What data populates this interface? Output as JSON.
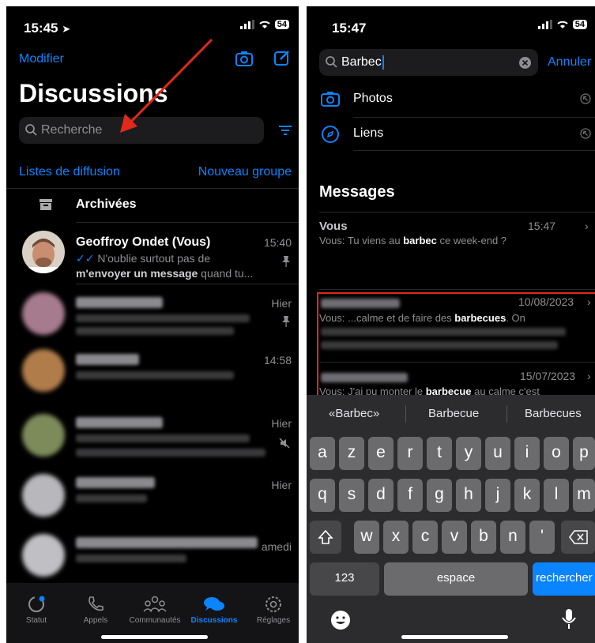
{
  "left": {
    "status": {
      "time": "15:45",
      "battery": "54"
    },
    "nav": {
      "edit": "Modifier",
      "title": "Discussions"
    },
    "search": {
      "placeholder": "Recherche"
    },
    "links": {
      "broadcast": "Listes de diffusion",
      "new_group": "Nouveau groupe"
    },
    "archived": "Archivées",
    "chats": [
      {
        "name": "Geoffroy Ondet (Vous)",
        "time": "15:40",
        "line1": "N'oublie surtout pas de",
        "line2_bold": "m'envoyer un message",
        "line2_rest": " quand tu..."
      },
      {
        "time": "Hier"
      },
      {
        "time": "14:58"
      },
      {
        "time": "Hier"
      },
      {
        "time": "Hier"
      },
      {
        "time": "amedi"
      }
    ],
    "tabs": [
      "Statut",
      "Appels",
      "Communautés",
      "Discussions",
      "Réglages"
    ]
  },
  "right": {
    "status": {
      "time": "15:47",
      "battery": "54"
    },
    "search": {
      "value": "Barbec",
      "cancel": "Annuler"
    },
    "filters": [
      "Photos",
      "Liens"
    ],
    "section": "Messages",
    "results": [
      {
        "from": "Vous",
        "time": "15:47",
        "prefix": "Vous: Tu viens au ",
        "bold": "barbec",
        "suffix": " ce week-end ?"
      },
      {
        "time": "10/08/2023",
        "prefix": "Vous: ...calme et de faire des ",
        "bold": "barbecues",
        "suffix": ". On"
      },
      {
        "time": "15/07/2023",
        "prefix": "Vous: J'ai pu monter le ",
        "bold": "barbecue",
        "suffix": " au calme c'est"
      }
    ],
    "suggestions": [
      "«Barbec»",
      "Barbecue",
      "Barbecues"
    ],
    "keyboard": {
      "row1": [
        "a",
        "z",
        "e",
        "r",
        "t",
        "y",
        "u",
        "i",
        "o",
        "p"
      ],
      "row2": [
        "q",
        "s",
        "d",
        "f",
        "g",
        "h",
        "j",
        "k",
        "l",
        "m"
      ],
      "row3": [
        "w",
        "x",
        "c",
        "v",
        "b",
        "n",
        "'"
      ],
      "numbers": "123",
      "space": "espace",
      "search": "rechercher"
    }
  },
  "colors": {
    "accent": "#0a84ff",
    "annotation": "#e0291a"
  }
}
